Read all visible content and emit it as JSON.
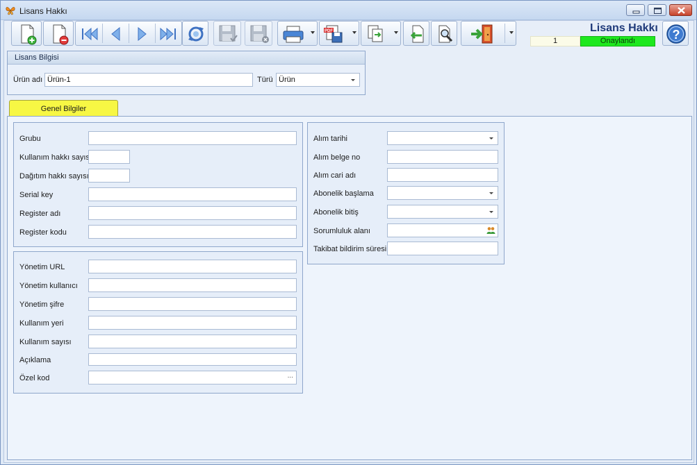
{
  "window": {
    "title": "Lisans Hakkı"
  },
  "header": {
    "title": "Lisans Hakkı",
    "record_number": "1",
    "status": "Onaylandı",
    "status_color": "#1ee81e"
  },
  "toolbar": {
    "buttons": [
      {
        "name": "new-record-button",
        "icon": "document-add-icon"
      },
      {
        "name": "delete-record-button",
        "icon": "document-delete-icon"
      },
      {
        "name": "first-record-button",
        "icon": "first-icon"
      },
      {
        "name": "previous-record-button",
        "icon": "previous-icon"
      },
      {
        "name": "next-record-button",
        "icon": "next-icon"
      },
      {
        "name": "last-record-button",
        "icon": "last-icon"
      },
      {
        "name": "refresh-button",
        "icon": "refresh-icon"
      },
      {
        "name": "save-button",
        "icon": "save-icon"
      },
      {
        "name": "cancel-save-button",
        "icon": "save-cancel-icon"
      },
      {
        "name": "print-button",
        "icon": "printer-icon"
      },
      {
        "name": "pdf-export-button",
        "icon": "pdf-save-icon"
      },
      {
        "name": "copy-export-button",
        "icon": "export-icon"
      },
      {
        "name": "import-button",
        "icon": "import-icon"
      },
      {
        "name": "search-button",
        "icon": "document-search-icon"
      },
      {
        "name": "exit-button",
        "icon": "exit-door-icon"
      }
    ]
  },
  "license_info": {
    "title": "Lisans Bilgisi",
    "product_name_label": "Ürün adı",
    "product_name_value": "Ürün-1",
    "type_label": "Türü",
    "type_value": "Ürün"
  },
  "tabs": [
    {
      "label": "Genel Bilgiler"
    }
  ],
  "general": {
    "group1": [
      {
        "label": "Grubu",
        "value": ""
      },
      {
        "label": "Kullanım hakkı sayısı",
        "value": ""
      },
      {
        "label": "Dağıtım hakkı sayısı",
        "value": ""
      },
      {
        "label": "Serial key",
        "value": ""
      },
      {
        "label": "Register adı",
        "value": ""
      },
      {
        "label": "Register kodu",
        "value": ""
      }
    ],
    "group2": [
      {
        "label": "Yönetim URL",
        "value": ""
      },
      {
        "label": "Yönetim kullanıcı",
        "value": ""
      },
      {
        "label": "Yönetim şifre",
        "value": ""
      },
      {
        "label": "Kullanım yeri",
        "value": ""
      },
      {
        "label": "Kullanım sayısı",
        "value": ""
      },
      {
        "label": "Açıklama",
        "value": ""
      },
      {
        "label": "Özel kod",
        "value": "",
        "button": "..."
      }
    ],
    "group3": [
      {
        "label": "Alım tarihi",
        "value": ""
      },
      {
        "label": "Alım belge no",
        "value": ""
      },
      {
        "label": "Alım cari adı",
        "value": ""
      },
      {
        "label": "Abonelik başlama",
        "value": ""
      },
      {
        "label": "Abonelik bitiş",
        "value": ""
      },
      {
        "label": "Sorumluluk alanı",
        "value": ""
      },
      {
        "label": "Takibat bildirim süresi",
        "value": ""
      }
    ]
  }
}
